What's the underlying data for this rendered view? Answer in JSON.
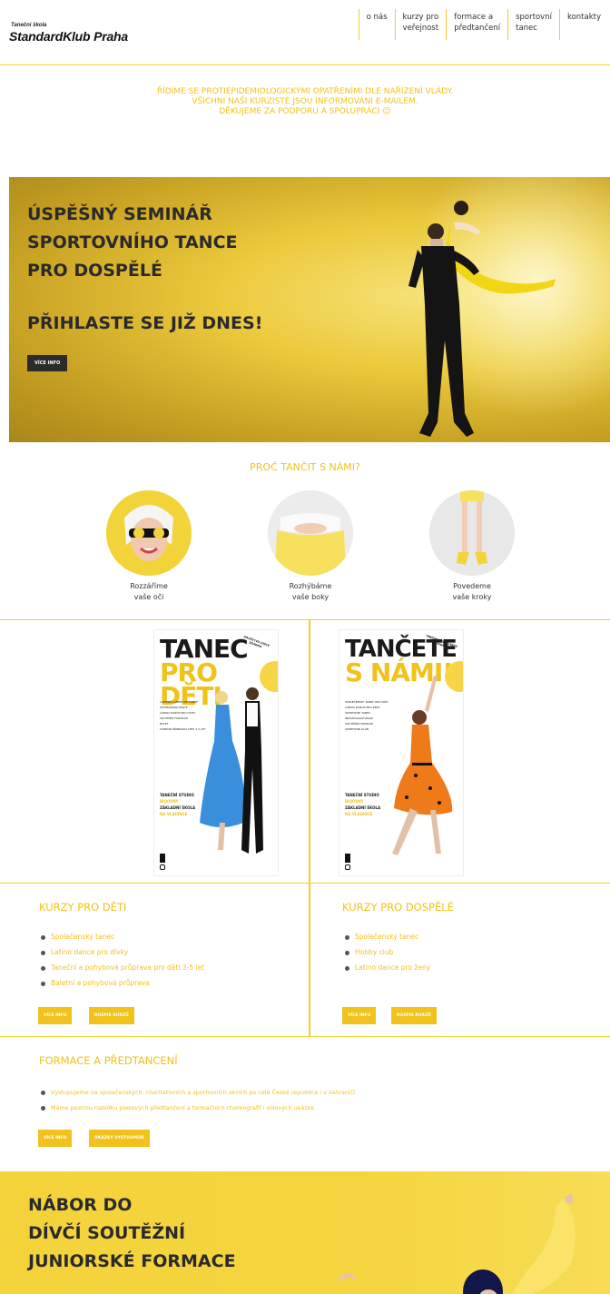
{
  "header": {
    "logo_small": "Taneční škola",
    "logo_big": "StandardKlub Praha",
    "nav": [
      {
        "label1": "o nás",
        "label2": ""
      },
      {
        "label1": "kurzy pro",
        "label2": "veřejnost"
      },
      {
        "label1": "formace a",
        "label2": "předtančení"
      },
      {
        "label1": "sportovní",
        "label2": "tanec"
      },
      {
        "label1": "kontakty",
        "label2": ""
      }
    ]
  },
  "notice": {
    "line1": "ŘÍDÍME SE PROTIEPIDEMIOLOGICKÝMI OPATŘENÍMI DLE NAŘÍZENÍ VLÁDY.",
    "line2": "VŠICHNI NAŠI KURZISTÉ JSOU INFORMOVÁNI E-MAILEM.",
    "line3": "DĚKUJEME ZA PODPORU A SPOLUPRÁCI 😉"
  },
  "hero": {
    "title_lines": [
      "ÚSPĚŠNÝ SEMINÁŘ",
      "SPORTOVNÍHO TANCE",
      "PRO DOSPĚLÉ"
    ],
    "subtitle": "PŘIHLASTE SE JIŽ DNES!",
    "button": "VÍCE INFO"
  },
  "why": {
    "title": "PROČ TANČIT S NÁMI?",
    "items": [
      {
        "line1": "Rozzáříme",
        "line2": "vaše oči"
      },
      {
        "line1": "Rozhýbáme",
        "line2": "vaše boky"
      },
      {
        "line1": "Povedeme",
        "line2": "vaše kroky"
      }
    ]
  },
  "posters": [
    {
      "h1": "TANEC",
      "h2": "PRO DĚTI",
      "badge": "DRUŽSTVO LYNCE ZDARMA",
      "list": [
        "LATINSKO-AMERICKÉ TANCE",
        "STANDARDNÍ TANCE",
        "LATINO DANCE PRO DÍVKY",
        "SOUTĚŽNÍ FORMACE",
        "BALET",
        "TANEČNÍ PŘÍPRAVKA DĚTI 3-5 LET"
      ],
      "studio": "TANEČNÍ STUDIO",
      "studio_loc": "BOJOVNÝ",
      "school": "ZÁKLADNÍ ŠKOLA",
      "school_loc": "NA VLADINCE"
    },
    {
      "h1": "TANČETE",
      "h2": "S NÁMI!",
      "badge": "OBJEDNÁVEJTE LEKCE ZDARMA",
      "list": [
        "SPOLEČENSKÝ TANEC PRO PÁRY",
        "LATINO DANCE PRO ŽENY",
        "SPORTOVNÍ TANEC",
        "INDIVIDUÁLNÍ LEKCE",
        "SOUTĚŽNÍ FORMACE",
        "SPORTOVNÍ KLUB"
      ],
      "studio": "TANEČNÍ STUDIO",
      "studio_loc": "BOJOVNÝ",
      "school": "ZÁKLADNÍ ŠKOLA",
      "school_loc": "NA VLADINCE"
    }
  ],
  "kids": {
    "title": "KURZY PRO DĚTI",
    "items": [
      "Společenský tanec",
      "Latino dance pro dívky",
      "Taneční a pohybová průprava pro děti 3-5 let",
      "Baletní a pohybová průprava"
    ],
    "btn1": "VÍCE INFO",
    "btn2": "ROZPIS KURZŮ"
  },
  "adults": {
    "title": "KURZY PRO DOSPĚLÉ",
    "items": [
      "Společenský tanec",
      "Hobby club",
      "Latino dance pro ženy"
    ],
    "btn1": "VÍCE INFO",
    "btn2": "ROZPIS KURZŮ"
  },
  "formace": {
    "title": "FORMACE A PŘEDTANCENÍ",
    "items": [
      "Vystupujeme na společenských, charitativních a sportovních akcích po celé České republice i v zahraničí.",
      "Máme pestrou nabídku plesových předtančení a formačních choreografií i sólových ukázek."
    ],
    "btn1": "VÍCE INFO",
    "btn2": "UKÁZKY VYSTOUPENÍ"
  },
  "bottom": {
    "title_lines": [
      "NÁBOR DO",
      "DÍVČÍ SOUTĚŽNÍ",
      "JUNIORSKÉ FORMACE"
    ]
  },
  "colors": {
    "accent": "#f0c21b",
    "dark": "#2b2b2b"
  }
}
